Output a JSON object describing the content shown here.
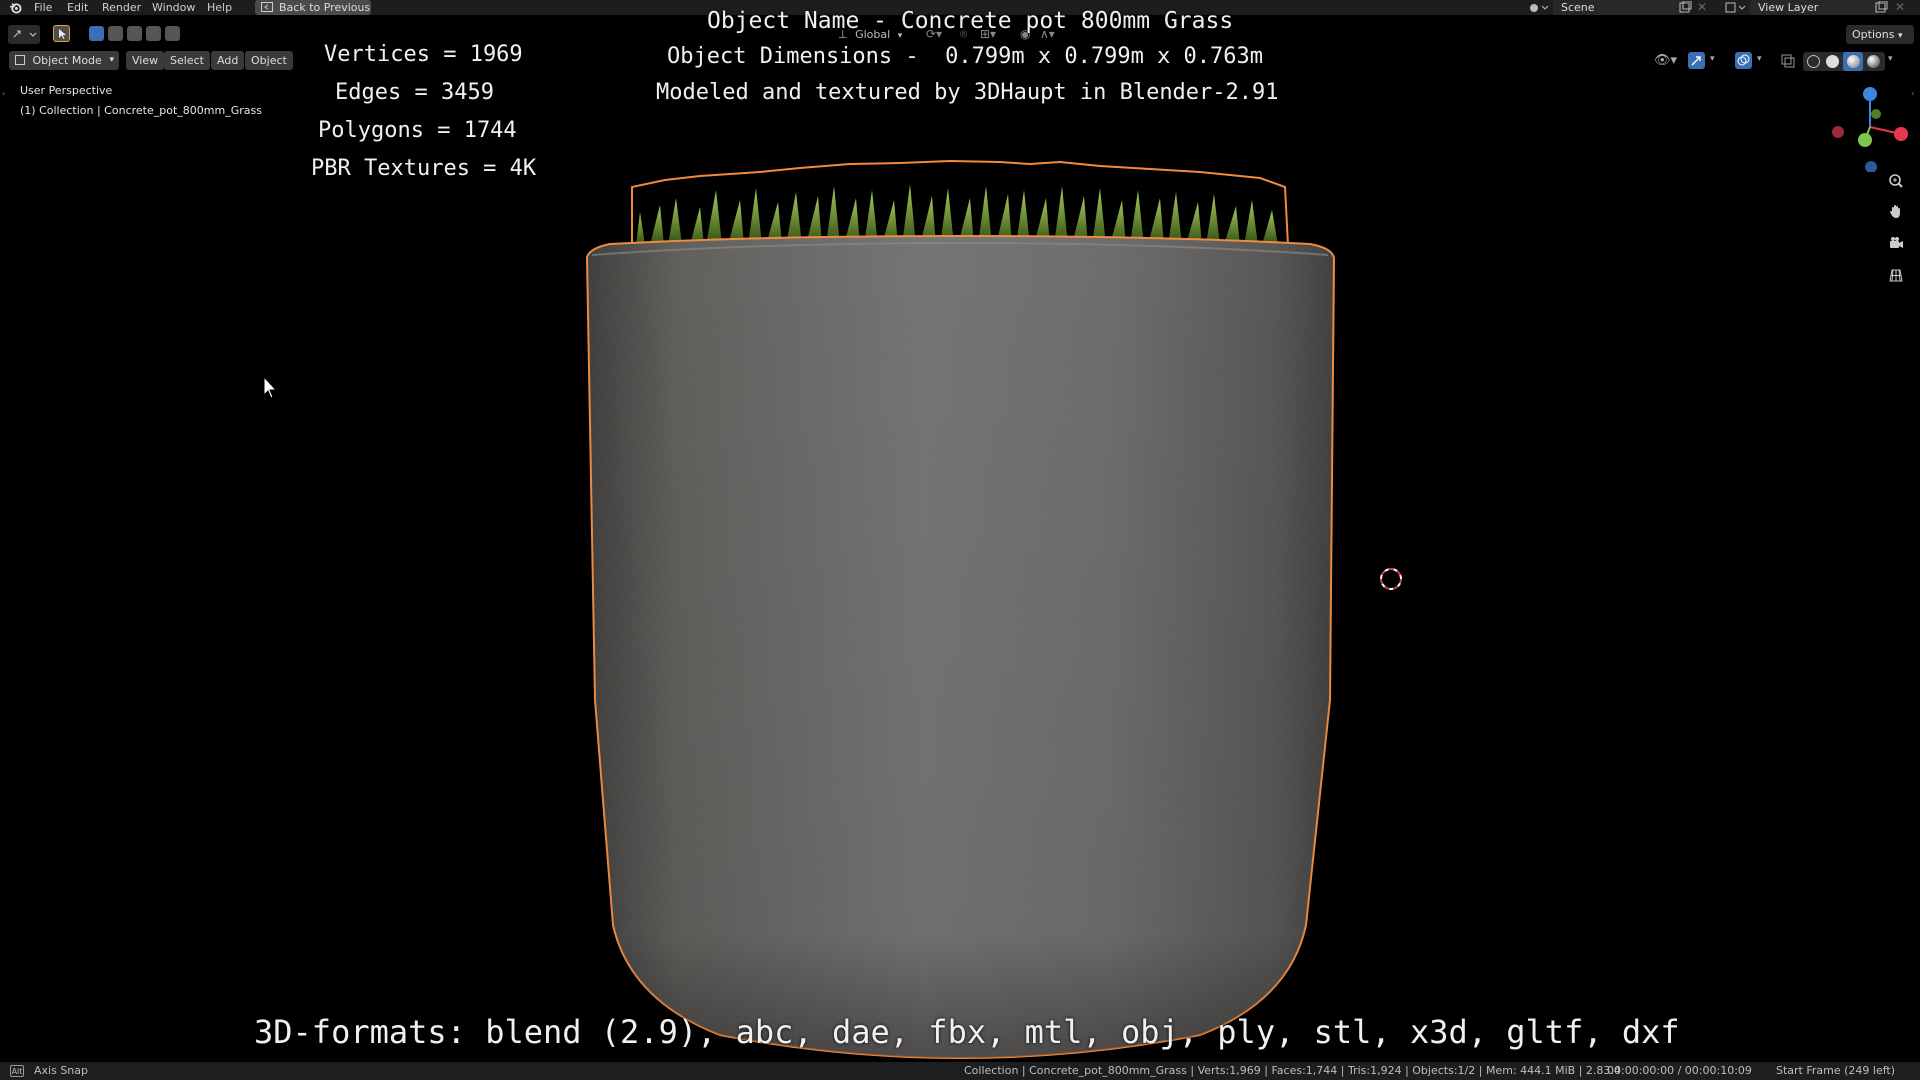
{
  "colors": {
    "topbar_bg": "#1d1d1d",
    "viewport_bg": "#000000",
    "selection_outline": "#f08a3c",
    "concrete": "#6e6c69",
    "grass": "#5f8f2a",
    "axis_x": "#e8384f",
    "axis_y": "#7ec74a",
    "axis_z": "#3b86e0"
  },
  "menubar": {
    "items": [
      "File",
      "Edit",
      "Render",
      "Window",
      "Help"
    ],
    "back_button": "Back to Previous",
    "scene_label": "Scene",
    "view_layer_label": "View Layer"
  },
  "header": {
    "transform_orientation": "Global",
    "options_label": "Options",
    "mode": "Object Mode",
    "menus": [
      "View",
      "Select",
      "Add",
      "Object"
    ]
  },
  "viewport": {
    "perspective": "User Perspective",
    "collection": "(1) Collection | Concrete_pot_800mm_Grass",
    "stats": {
      "vertices": "Vertices = 1969",
      "edges": "Edges = 3459",
      "polygons": "Polygons = 1744",
      "textures": "PBR Textures = 4K"
    },
    "object_name": "Object Name - Concrete pot 800mm Grass",
    "object_dimensions": "Object Dimensions -  0.799m x 0.799m x 0.763m",
    "credit": "Modeled and textured by 3DHaupt in Blender-2.91",
    "formats": "3D-formats: blend (2.9), abc, dae, fbx, mtl, obj, ply, stl, x3d, gltf, dxf"
  },
  "statusbar": {
    "key_label": "Alt",
    "hint": "Axis Snap",
    "stats": "Collection | Concrete_pot_800mm_Grass | Verts:1,969 | Faces:1,744 | Tris:1,924 | Objects:1/2 | Mem: 444.1 MiB | 2.83.4",
    "timecode": "00:00:00:00 / 00:00:10:09",
    "frame": "Start Frame (249 left)"
  }
}
